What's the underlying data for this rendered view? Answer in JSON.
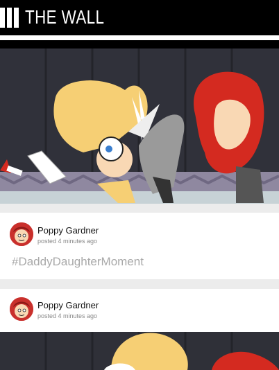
{
  "header": {
    "title": "THE WALL",
    "logo_icon": "three-bars-icon"
  },
  "posts": [
    {
      "username": "Poppy Gardner",
      "posted": "posted 4 minutes ago",
      "hashtag": "#DaddyDaughterMoment",
      "avatar_icon": "avatar-cartoon-girl-icon"
    },
    {
      "username": "Poppy Gardner",
      "posted": "posted 4 minutes ago",
      "avatar_icon": "avatar-cartoon-girl-icon"
    }
  ],
  "colors": {
    "header_bg": "#000000",
    "page_bg": "#ececec",
    "card_bg": "#ffffff",
    "hashtag": "#a9a9a9",
    "accent_red": "#d42a20",
    "wall_dark": "#2f3038"
  }
}
